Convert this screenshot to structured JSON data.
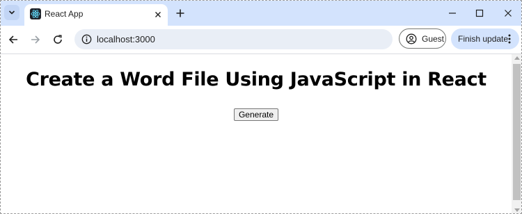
{
  "browser": {
    "tab": {
      "title": "React App",
      "favicon": "react-logo-icon"
    },
    "address_bar": {
      "url": "localhost:3000"
    },
    "profile": {
      "label": "Guest"
    },
    "update": {
      "label": "Finish update"
    },
    "colors": {
      "tabstrip": "#d3e3fd",
      "omnibox": "#e9eef6",
      "accent": "#d3e3fd"
    }
  },
  "page": {
    "heading": "Create a Word File Using JavaScript in React",
    "generate_button": "Generate"
  }
}
